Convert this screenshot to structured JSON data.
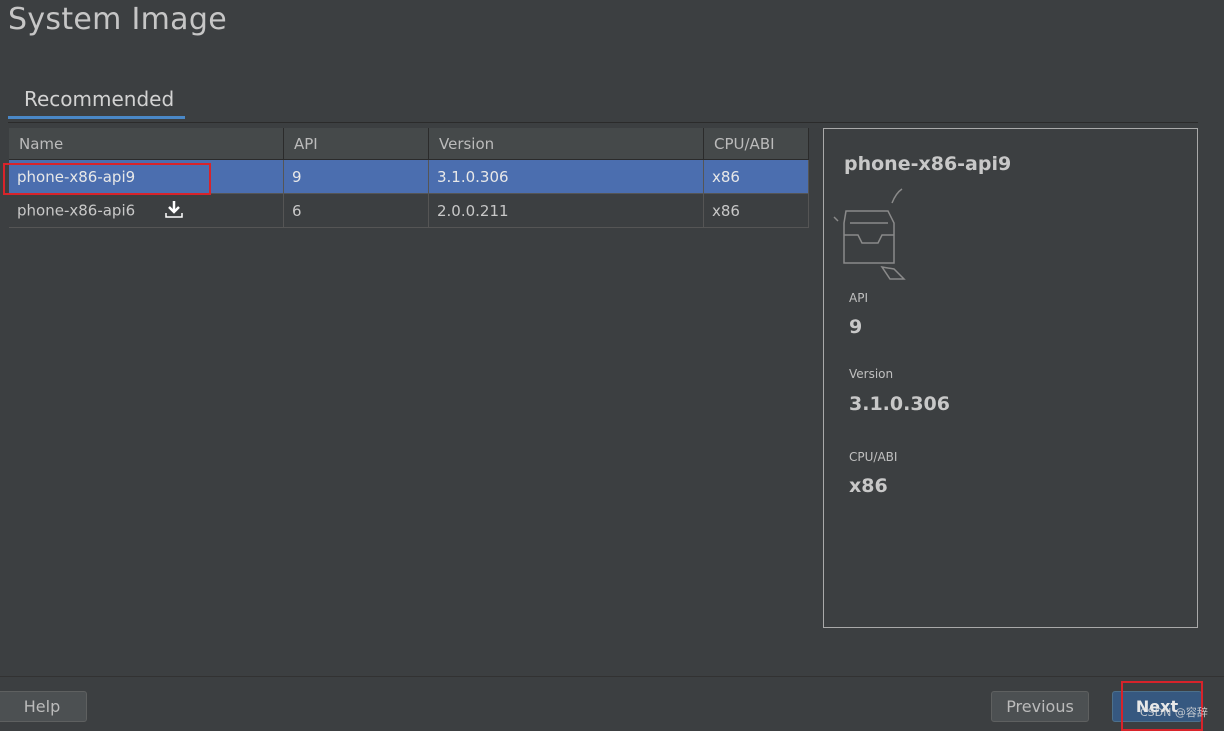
{
  "header": {
    "title": "System Image"
  },
  "tabs": [
    {
      "label": "Recommended",
      "active": true
    }
  ],
  "table": {
    "columns": [
      "Name",
      "API",
      "Version",
      "CPU/ABI"
    ],
    "rows": [
      {
        "name": "phone-x86-api9",
        "api": "9",
        "version": "3.1.0.306",
        "abi": "x86",
        "selected": true,
        "download_icon": null
      },
      {
        "name": "phone-x86-api6",
        "api": "6",
        "version": "2.0.0.211",
        "abi": "x86",
        "selected": false,
        "download_icon": "download-icon"
      }
    ]
  },
  "details": {
    "name": "phone-x86-api9",
    "icon": "empty-tray-icon",
    "api_label": "API",
    "api_value": "9",
    "version_label": "Version",
    "version_value": "3.1.0.306",
    "abi_label": "CPU/ABI",
    "abi_value": "x86"
  },
  "footer": {
    "help_label": "Help",
    "previous_label": "Previous",
    "next_label": "Next"
  },
  "watermark": "CSDN @容辞",
  "colors": {
    "background": "#3c3f41",
    "selection": "#4b6eaf",
    "tab_underline": "#4a88c7",
    "highlight_box": "#d8232a",
    "primary_button": "#365880"
  }
}
